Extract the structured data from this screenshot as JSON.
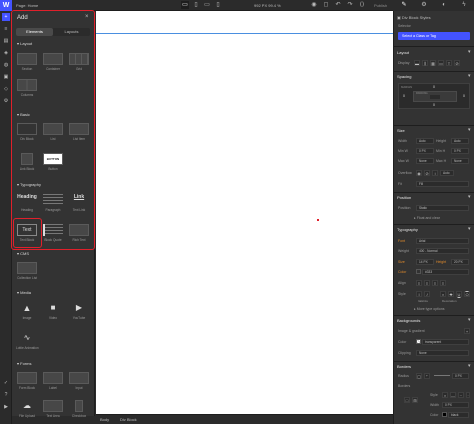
{
  "topbar": {
    "logo": "W",
    "page_label": "Page: Home",
    "dimensions": "992 PX  99.4 %",
    "publish": "Publish"
  },
  "left_rail": {
    "icons": [
      "add-icon",
      "navigator-icon",
      "pages-icon",
      "cms-icon",
      "ecommerce-icon",
      "assets-icon",
      "symbols-icon",
      "settings-icon"
    ]
  },
  "add_panel": {
    "title": "Add",
    "close": "×",
    "tabs": [
      "Elements",
      "Layouts"
    ],
    "sections": [
      {
        "name": "Layout",
        "items": [
          "Section",
          "Container",
          "Grid",
          "Columns"
        ]
      },
      {
        "name": "Basic",
        "items": [
          "Div Block",
          "List",
          "List Item",
          "Link Block",
          "Button"
        ]
      },
      {
        "name": "Typography",
        "items": [
          "Heading",
          "Paragraph",
          "Text Link",
          "Text Block",
          "Block Quote",
          "Rich Text"
        ]
      },
      {
        "name": "CMS",
        "items": [
          "Collection List"
        ]
      },
      {
        "name": "Media",
        "items": [
          "Image",
          "Video",
          "YouTube",
          "Lottie Animation"
        ]
      },
      {
        "name": "Forms",
        "items": [
          "Form Block",
          "Label",
          "Input",
          "File Upload",
          "Text Area",
          "Checkbox"
        ]
      }
    ],
    "tile_text": {
      "heading": "Heading",
      "link": "Link",
      "text": "Text",
      "button": "BUTTON"
    }
  },
  "breadcrumb": {
    "items": [
      "Body",
      "Div Block"
    ]
  },
  "right_panel": {
    "element_title": "Div Block Styles",
    "selector_label": "Selector",
    "selector_button": "Select a Class or Tag",
    "layout": {
      "title": "Layout",
      "display_label": "Display"
    },
    "spacing": {
      "title": "Spacing",
      "margin_label": "MARGIN",
      "padding_label": "PADDING",
      "values": [
        "0",
        "0",
        "0",
        "0"
      ]
    },
    "size": {
      "title": "Size",
      "width_label": "Width",
      "width": "Auto",
      "height_label": "Height",
      "height": "Auto",
      "minw_label": "Min W",
      "minw": "0",
      "minw_unit": "PX",
      "minh_label": "Min H",
      "minh": "0",
      "minh_unit": "PX",
      "maxw_label": "Max W",
      "maxw": "None",
      "maxh_label": "Max H",
      "maxh": "None",
      "overflow_label": "Overflow",
      "overflow_auto": "Auto",
      "fit_label": "Fit",
      "fit": "Fill"
    },
    "position": {
      "title": "Position",
      "position_label": "Position",
      "position_value": "Static",
      "float_clear": "Float and clear"
    },
    "typography": {
      "title": "Typography",
      "font_label": "Font",
      "font": "Arial",
      "weight_label": "Weight",
      "weight": "400 - Normal",
      "size_label": "Size",
      "size": "14",
      "size_unit": "PX",
      "height_label": "Height",
      "height": "20",
      "height_unit": "PX",
      "color_label": "Color",
      "color": "#333",
      "align_label": "Align",
      "style_label": "Style",
      "italicize": "Italicize",
      "decoration": "Decoration",
      "more": "More type options"
    },
    "backgrounds": {
      "title": "Backgrounds",
      "image_gradient": "Image & gradient",
      "color_label": "Color",
      "color": "transparent",
      "clipping_label": "Clipping",
      "clipping": "None"
    },
    "borders": {
      "title": "Borders",
      "radius_label": "Radius",
      "radius": "0",
      "radius_unit": "PX",
      "borders_label": "Borders",
      "style_label": "Style",
      "width_label": "Width",
      "width": "0",
      "width_unit": "PX",
      "color_label": "Color",
      "color": "black"
    }
  },
  "colors": {
    "accent": "#4353ff",
    "highlight": "#e0202b",
    "panel": "#333333",
    "canvas": "#ffffff"
  }
}
